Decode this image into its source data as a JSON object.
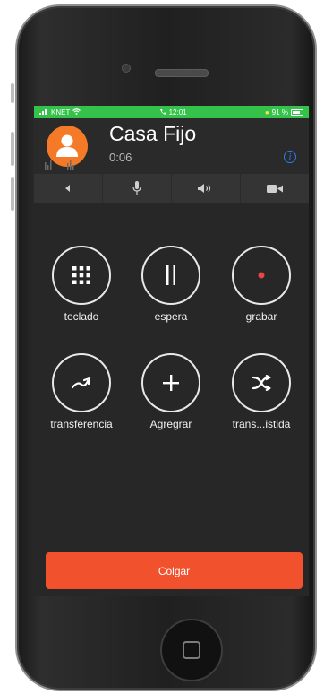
{
  "status_bar": {
    "carrier": "KNET",
    "time": "12:01",
    "battery": "91 %"
  },
  "call": {
    "contact_name": "Casa Fijo",
    "duration": "0:06",
    "info_glyph": "i"
  },
  "toolbar": [
    {
      "name": "back",
      "icon": "triangle-left-icon"
    },
    {
      "name": "mute",
      "icon": "microphone-icon"
    },
    {
      "name": "speaker",
      "icon": "speaker-icon"
    },
    {
      "name": "video",
      "icon": "video-camera-icon"
    }
  ],
  "actions": [
    {
      "label": "teclado",
      "icon": "keypad-icon"
    },
    {
      "label": "espera",
      "icon": "pause-icon"
    },
    {
      "label": "grabar",
      "icon": "record-icon"
    },
    {
      "label": "transferencia",
      "icon": "transfer-icon"
    },
    {
      "label": "Agregrar",
      "icon": "plus-icon"
    },
    {
      "label": "trans...istida",
      "icon": "assisted-transfer-icon"
    }
  ],
  "hangup_label": "Colgar",
  "colors": {
    "accent": "#f47a28",
    "hangup": "#f1512c",
    "status_green": "#35c24a",
    "record_red": "#e84545",
    "info_blue": "#2f7bf5"
  }
}
